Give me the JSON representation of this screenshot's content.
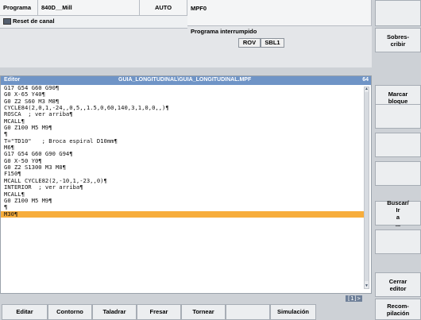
{
  "header": {
    "program_label": "Programa",
    "program_name": "840D__Mill",
    "mode": "AUTO",
    "program_file": "MPF0",
    "reset_label": "Reset de canal",
    "status_text": "Programa interrumpido",
    "flags": [
      "ROV",
      "SBL1"
    ]
  },
  "editor": {
    "title_left": "Editor",
    "title_path": "GUIA_LONGITUDINAL\\GUIA_LONGITUDINAL.MPF",
    "title_right": "64",
    "lines": [
      "G17 G54 G60 G90¶",
      "G0 X-65 Y40¶",
      "G0 Z2 S60 M3 M8¶",
      "CYCLE84(2,0,1,-24,,0,5,,1.5,0,60,140,3,1,0,0,,)¶",
      "ROSCA  ; ver arriba¶",
      "MCALL¶",
      "G0 Z100 M5 M9¶",
      "¶",
      "T=\"TD10\"   ; Broca espiral D10mm¶",
      "M6¶",
      "G17 G54 G60 G90 G94¶",
      "G0 X-50 Y0¶",
      "G0 Z2 S1300 M3 M8¶",
      "F150¶",
      "MCALL CYCLE82(2,-10,1,-23,,0)¶",
      "INTERIOR  ; ver arriba¶",
      "MCALL¶",
      "G0 Z100 M5 M9¶",
      "¶",
      "M30¶"
    ],
    "selected_index": 19,
    "page_indicator": "[1]>"
  },
  "right_softkeys": [
    "",
    "Sobres- cribir",
    "Marcar bloque",
    "",
    "",
    "",
    "Buscar/ Ir a ...",
    "",
    "Cerrar editor",
    "Recom- pilación"
  ],
  "bottom_softkeys": [
    "Editar",
    "Contorno",
    "Taladrar",
    "Fresar",
    "Tornear",
    "",
    "Simulación"
  ],
  "colors": {
    "accent": "#6f94c6",
    "selection": "#f7ad3b"
  }
}
